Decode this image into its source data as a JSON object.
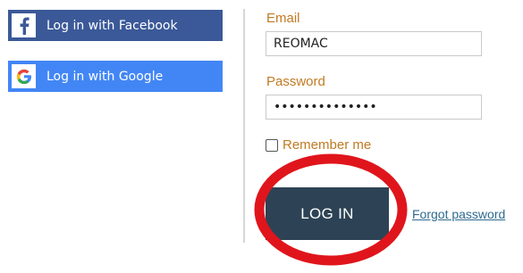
{
  "social": {
    "facebook_label": "Log in with Facebook",
    "google_label": "Log in with Google",
    "facebook_icon": "facebook-f-icon",
    "google_icon": "google-g-icon"
  },
  "form": {
    "email_label": "Email",
    "email_value": "REOMAC",
    "password_label": "Password",
    "password_value": "••••••••••••••",
    "remember_label": "Remember me",
    "remember_checked": false,
    "login_label": "LOG IN",
    "forgot_label": "Forgot password"
  },
  "colors": {
    "facebook": "#3b5998",
    "google": "#4286f5",
    "label": "#c07a22",
    "login_button": "#2d4355",
    "link": "#2f6a8f",
    "annotation": "#e0151c"
  },
  "annotation": {
    "shape": "red-circle",
    "target": "login-button"
  }
}
